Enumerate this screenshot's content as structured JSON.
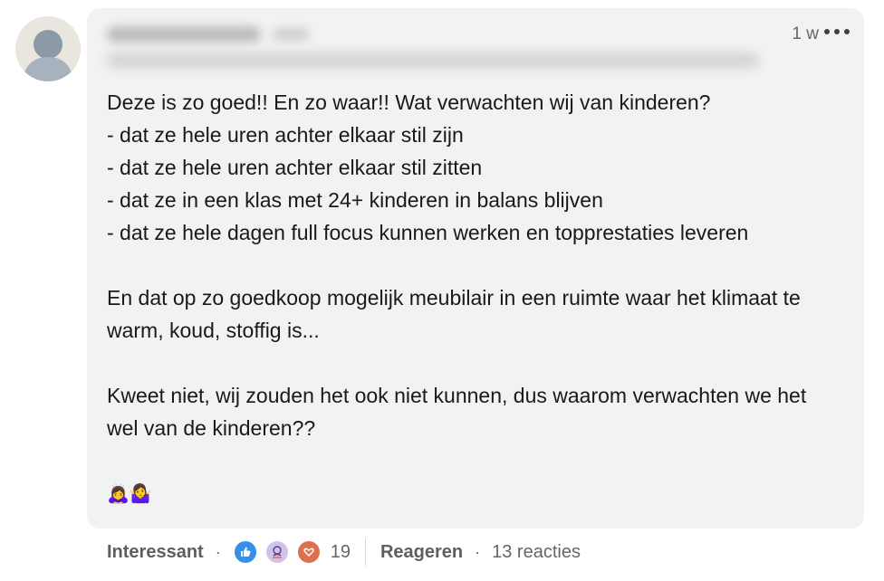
{
  "comment": {
    "author_avatar_icon": "person-silhouette-icon",
    "author_name_blurred": true,
    "timestamp": "1 w",
    "more_icon": "ellipsis-icon",
    "body": "Deze is zo goed!! En zo waar!! Wat verwachten wij van kinderen?\n- dat ze hele uren achter elkaar stil zijn\n- dat ze hele uren achter elkaar stil zitten\n- dat ze in een klas met 24+ kinderen in balans blijven\n- dat ze hele dagen full focus kunnen werken en topprestaties leveren\n\nEn dat op zo goedkoop mogelijk meubilair in een ruimte waar het klimaat te warm, koud, stoffig is...\n\nKweet niet, wij zouden het ook niet kunnen, dus waarom verwachten we het wel van de kinderen??",
    "emojis": "🙇‍♀️🤷‍♀️"
  },
  "actions": {
    "reaction_label": "Interessant",
    "reaction_icons": [
      "like-icon",
      "insightful-icon",
      "love-icon"
    ],
    "reaction_count": "19",
    "reply_label": "Reageren",
    "reply_count_label": "13 reacties"
  },
  "colors": {
    "bubble_bg": "#f2f2f2",
    "like": "#378fe9",
    "insightful": "#d1c2e9",
    "love": "#df704d",
    "muted_text": "#666666"
  }
}
